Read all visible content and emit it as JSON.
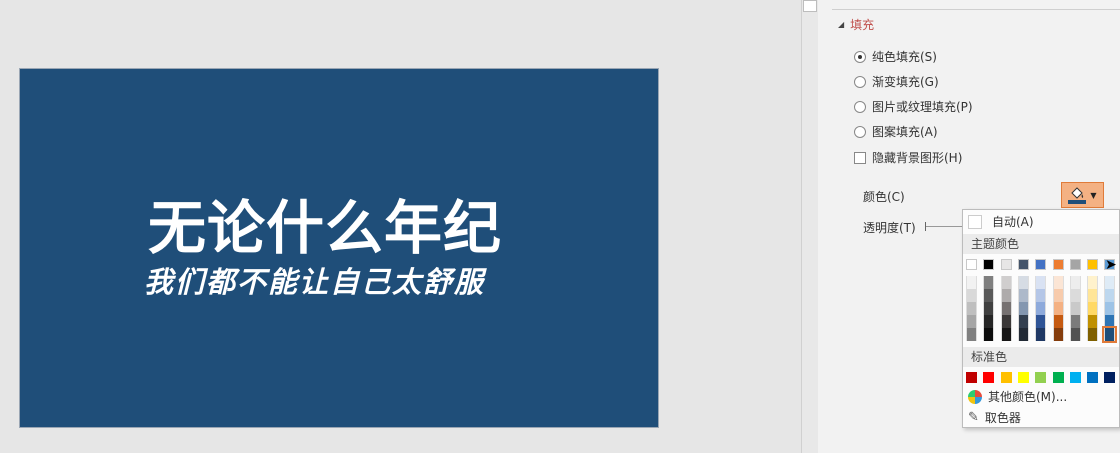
{
  "slide": {
    "background": "#1f4e79",
    "title": "无论什么年纪",
    "subtitle": "我们都不能让自己太舒服"
  },
  "panel": {
    "section": "填充",
    "options": [
      {
        "label": "纯色填充(S)",
        "checked": true
      },
      {
        "label": "渐变填充(G)",
        "checked": false
      },
      {
        "label": "图片或纹理填充(P)",
        "checked": false
      },
      {
        "label": "图案填充(A)",
        "checked": false
      }
    ],
    "hide_bg": "隐藏背景图形(H)",
    "color_label": "颜色(C)",
    "transparency_label": "透明度(T)",
    "color_value": "#1f4e79"
  },
  "dropdown": {
    "auto": "自动(A)",
    "theme_header": "主题颜色",
    "theme_top": [
      "#ffffff",
      "#000000",
      "#e7e6e6",
      "#44546a",
      "#4472c4",
      "#ed7d31",
      "#a5a5a5",
      "#ffc000",
      "#5b9bd5"
    ],
    "theme_cols": [
      [
        "#f2f2f2",
        "#d9d9d9",
        "#bfbfbf",
        "#a6a6a6",
        "#808080"
      ],
      [
        "#7f7f7f",
        "#595959",
        "#404040",
        "#262626",
        "#0d0d0d"
      ],
      [
        "#d0cece",
        "#aeabab",
        "#767171",
        "#3b3838",
        "#171616"
      ],
      [
        "#d6dce4",
        "#adb9ca",
        "#8497b0",
        "#333f4f",
        "#222a35"
      ],
      [
        "#d9e2f3",
        "#b4c6e7",
        "#8eaadb",
        "#2f5496",
        "#1f3864"
      ],
      [
        "#fbe5d5",
        "#f7cbac",
        "#f4b183",
        "#c55a11",
        "#843c0c"
      ],
      [
        "#ededed",
        "#dbdbdb",
        "#c9c9c9",
        "#7b7b7b",
        "#525252"
      ],
      [
        "#fff2cc",
        "#ffe598",
        "#ffd966",
        "#bf9000",
        "#7f6000"
      ],
      [
        "#deebf6",
        "#bdd7ee",
        "#9dc3e6",
        "#2e75b5",
        "#1f4e79"
      ]
    ],
    "standard_header": "标准色",
    "standard": [
      "#c00000",
      "#ff0000",
      "#ffc000",
      "#ffff00",
      "#92d050",
      "#00b050",
      "#00b0f0",
      "#0070c0",
      "#002060",
      "#7030a0"
    ],
    "more": "其他颜色(M)...",
    "picker": "取色器"
  }
}
